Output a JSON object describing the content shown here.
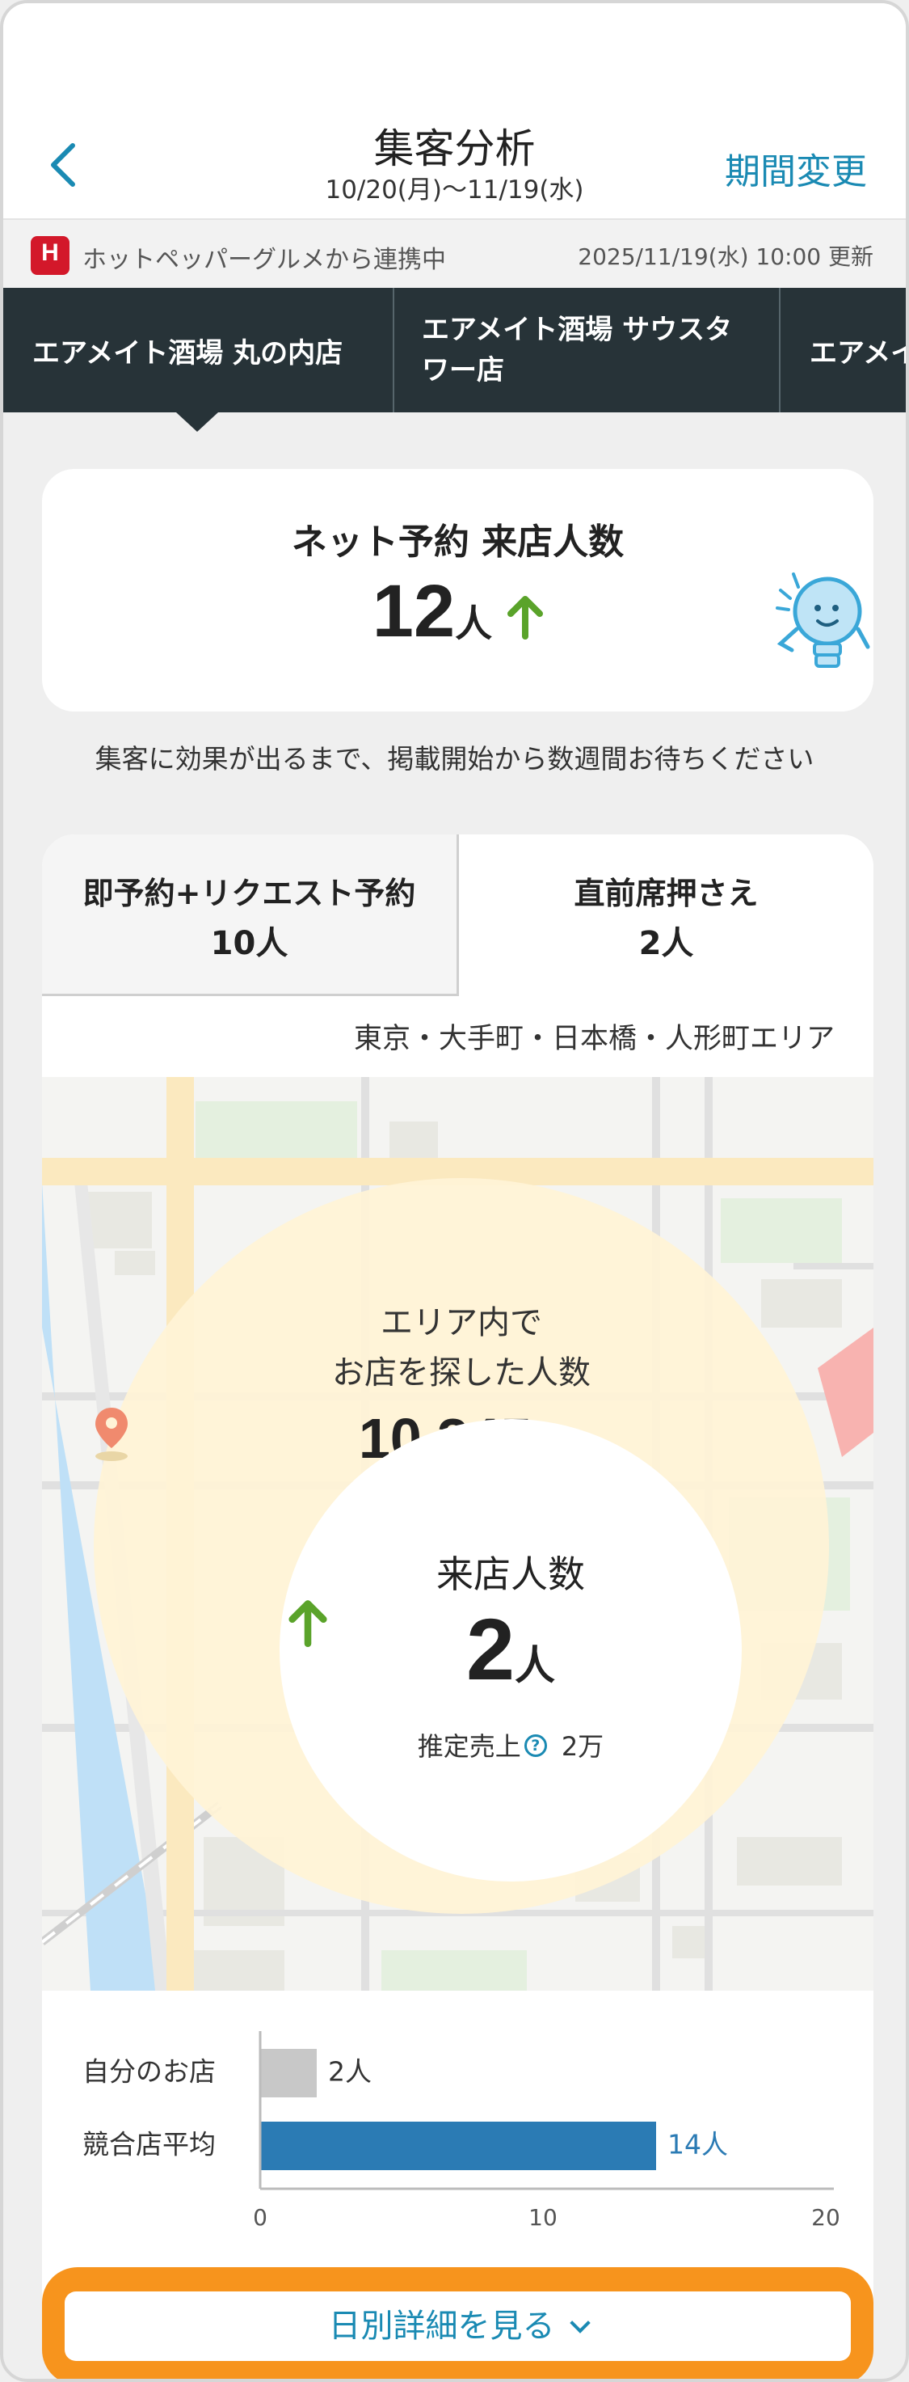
{
  "header": {
    "title": "集客分析",
    "period": "10/20(月)〜11/19(水)",
    "change_period": "期間変更"
  },
  "infobar": {
    "logo_letter": "H",
    "source": "ホットペッパーグルメから連携中",
    "updated": "2025/11/19(水) 10:00 更新"
  },
  "store_tabs": [
    {
      "label": "エアメイト酒場 丸の内店"
    },
    {
      "label_line1": "エアメイト酒場 サウスタ",
      "label_line2": "ワー店"
    },
    {
      "label": "エアメイ"
    }
  ],
  "summary": {
    "title": "ネット予約 来店人数",
    "value": "12",
    "unit": "人",
    "trend": "up"
  },
  "note": "集客に効果が出るまで、掲載開始から数週間お待ちください",
  "reservation_tabs": [
    {
      "label": "即予約+リクエスト予約",
      "value": "10",
      "unit": "人"
    },
    {
      "label": "直前席押さえ",
      "value": "2",
      "unit": "人"
    }
  ],
  "area": "東京・大手町・日本橋・人形町エリア",
  "search": {
    "line1": "エリア内で",
    "line2": "お店を探した人数",
    "value": "10,345",
    "unit": "人"
  },
  "visits": {
    "title": "来店人数",
    "value": "2",
    "unit": "人",
    "trend": "up",
    "sales_label": "推定売上",
    "sales_value": "2万"
  },
  "chart_data": {
    "type": "bar",
    "orientation": "horizontal",
    "categories": [
      "自分のお店",
      "競合店平均"
    ],
    "values": [
      2,
      14
    ],
    "value_labels": [
      "2人",
      "14人"
    ],
    "colors": [
      "#c8c8c8",
      "#2b7bb4"
    ],
    "xlim": [
      0,
      20
    ],
    "ticks": [
      "0",
      "10",
      "20"
    ]
  },
  "button": {
    "label": "日別詳細を見る"
  },
  "colors": {
    "accent": "#1a8ab3",
    "tab_bg": "#273338",
    "trend_up": "#5aa32a",
    "button_frame": "#f7941d"
  }
}
